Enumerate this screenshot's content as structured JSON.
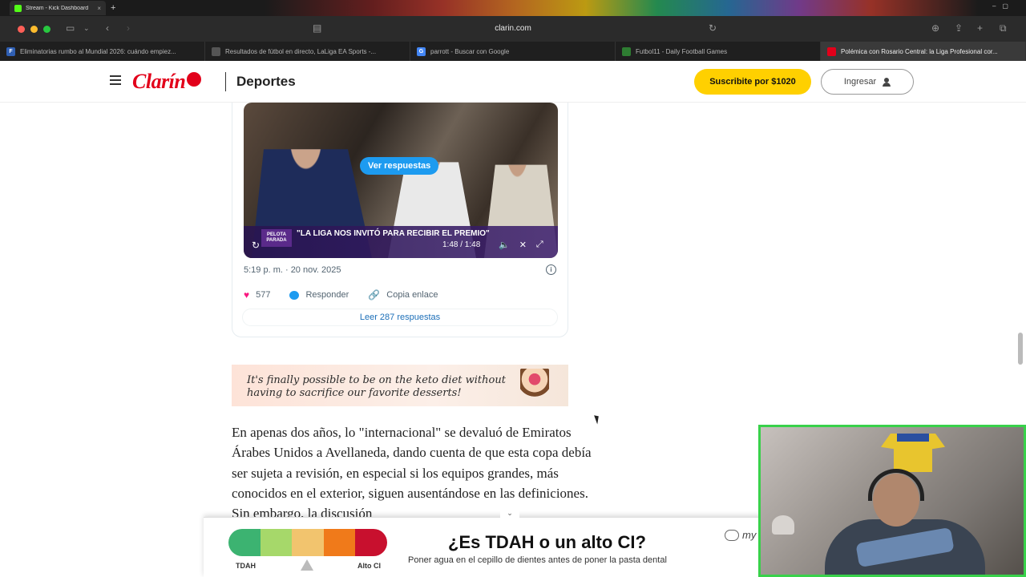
{
  "os": {
    "tab_title": "Stream - Kick Dashboard",
    "tab_close": "×",
    "new_tab": "+"
  },
  "browser": {
    "url": "clarin.com",
    "tabs": [
      {
        "title": "Eliminatorias rumbo al Mundial 2026: cuándo empiez...",
        "favicon_color": "#2f5fb3",
        "favicon_letter": "F"
      },
      {
        "title": "Resultados de fútbol en directo, LaLiga EA Sports -...",
        "favicon_color": "#555555",
        "favicon_letter": ""
      },
      {
        "title": "parrott - Buscar con Google",
        "favicon_color": "#4285f4",
        "favicon_letter": "G"
      },
      {
        "title": "Futbol11 - Daily Football Games",
        "favicon_color": "#2e7d32",
        "favicon_letter": ""
      },
      {
        "title": "Polémica con Rosario Central: la Liga Profesional cor...",
        "favicon_color": "#e2001a",
        "favicon_letter": ""
      }
    ],
    "active_tab_index": 4
  },
  "header": {
    "logo": "Clarín",
    "section": "Deportes",
    "subscribe_label": "Suscribite por $1020",
    "login_label": "Ingresar"
  },
  "tweet": {
    "video_button": "Ver respuestas",
    "lower_third_text": "\"LA LIGA NOS INVITÓ PARA RECIBIR EL PREMIO\"",
    "lower_third_logo": "PELOTA PARADA",
    "time_display": "1:48 / 1:48",
    "date": "5:19 p. m. · 20 nov. 2025",
    "likes": "577",
    "reply_label": "Responder",
    "copy_link_label": "Copia enlace",
    "read_replies_label": "Leer 287 respuestas"
  },
  "ad_banner": {
    "text": "It's finally possible to be on the keto diet without having to sacrifice our favorite desserts!"
  },
  "article": {
    "paragraph": "En apenas dos años, lo \"internacional\" se devaluó de Emiratos Árabes Unidos a Avellaneda, dando cuenta de que esta copa debía ser sujeta a revisión, en especial si los equipos grandes, más conocidos en el exterior, siguen ausentándose en las definiciones. Sin embargo, la discusión"
  },
  "bottom_ad": {
    "question": "¿Es TDAH o un alto CI?",
    "subtitle": "Poner agua en el cepillo de dientes antes de poner la pasta dental",
    "left_label": "TDAH",
    "right_label": "Alto CI",
    "brand": "my",
    "meter_colors": [
      "#3cb371",
      "#a6d86a",
      "#f2c46e",
      "#f07a1a",
      "#c8102e"
    ]
  }
}
